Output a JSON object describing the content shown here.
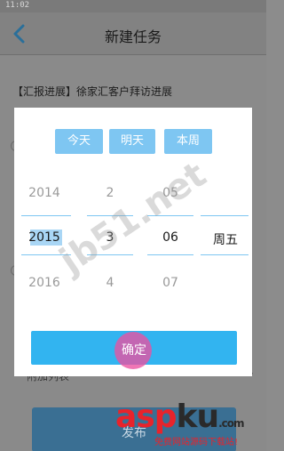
{
  "status_bar": {
    "time": "11:02"
  },
  "header": {
    "title": "新建任务",
    "back_icon": "chevron-left-icon"
  },
  "task": {
    "title": "【汇报进展】徐家汇客户拜访进展"
  },
  "background": {
    "list_label": "附加列表",
    "publish_label": "发布"
  },
  "date_picker": {
    "quick_buttons": [
      "今天",
      "明天",
      "本周"
    ],
    "year": {
      "prev": "2014",
      "selected": "2015",
      "next": "2016"
    },
    "month": {
      "prev": "2",
      "selected": "3",
      "next": "4"
    },
    "day": {
      "prev": "05",
      "selected": "06",
      "next": "07"
    },
    "weekday": {
      "selected": "周五"
    },
    "confirm_label": "确定"
  },
  "colors": {
    "accent": "#32b4f0",
    "quick_button": "#7ec6f2",
    "touch_indicator": "#ec50a0"
  },
  "watermark": {
    "diagonal": "jb51.net",
    "brand_red": "asp",
    "brand_dark": "ku",
    "brand_suffix": ".com",
    "subtitle": "免费网站源码下载站!"
  }
}
